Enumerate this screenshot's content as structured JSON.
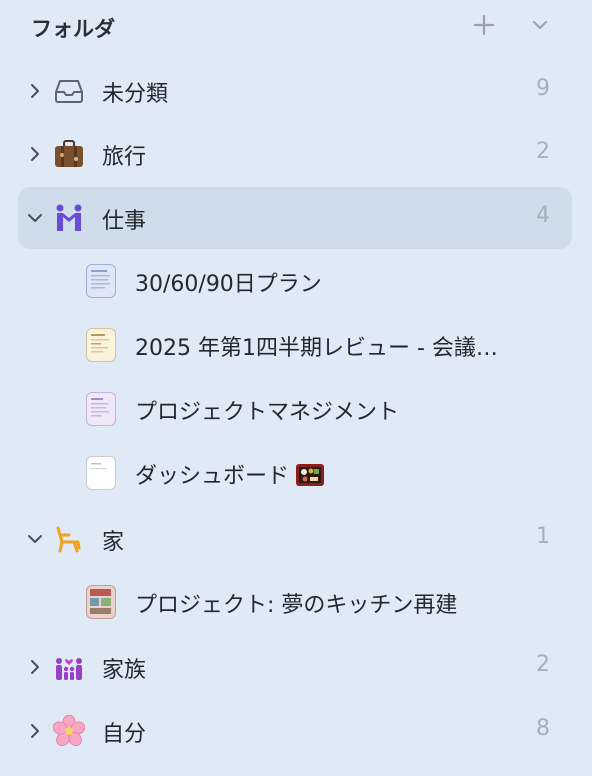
{
  "header": {
    "title": "フォルダ",
    "add_icon": "plus-icon",
    "collapse_icon": "chevron-down-icon"
  },
  "folders": [
    {
      "label": "未分類",
      "count": "9",
      "icon": "inbox-tray-icon",
      "expanded": false
    },
    {
      "label": "旅行",
      "count": "2",
      "icon": "suitcase-icon",
      "expanded": false
    },
    {
      "label": "仕事",
      "count": "4",
      "icon": "people-holding-hands-icon",
      "expanded": true,
      "selected": true
    },
    {
      "label": "家",
      "count": "1",
      "icon": "armchair-icon",
      "expanded": true
    },
    {
      "label": "家族",
      "count": "2",
      "icon": "family-icon",
      "expanded": false
    },
    {
      "label": "自分",
      "count": "8",
      "icon": "cherry-blossom-icon",
      "expanded": false
    }
  ],
  "notes": [
    {
      "label": "30/60/90日プラン",
      "thumb": "document-thumbnail",
      "folder": "仕事"
    },
    {
      "label": "2025 年第1四半期レビュー - 会議…",
      "thumb": "document-thumbnail",
      "folder": "仕事"
    },
    {
      "label": "プロジェクトマネジメント",
      "thumb": "document-thumbnail",
      "folder": "仕事"
    },
    {
      "label": "ダッシュボード",
      "thumb": "document-thumbnail",
      "emoji": "bento-box-icon",
      "folder": "仕事"
    },
    {
      "label": "プロジェクト: 夢のキッチン再建",
      "thumb": "photo-thumbnail",
      "folder": "家"
    }
  ],
  "colors": {
    "background": "#dfeaf6",
    "selected_row": "#cfdce9",
    "count_text": "#a8afb8"
  }
}
